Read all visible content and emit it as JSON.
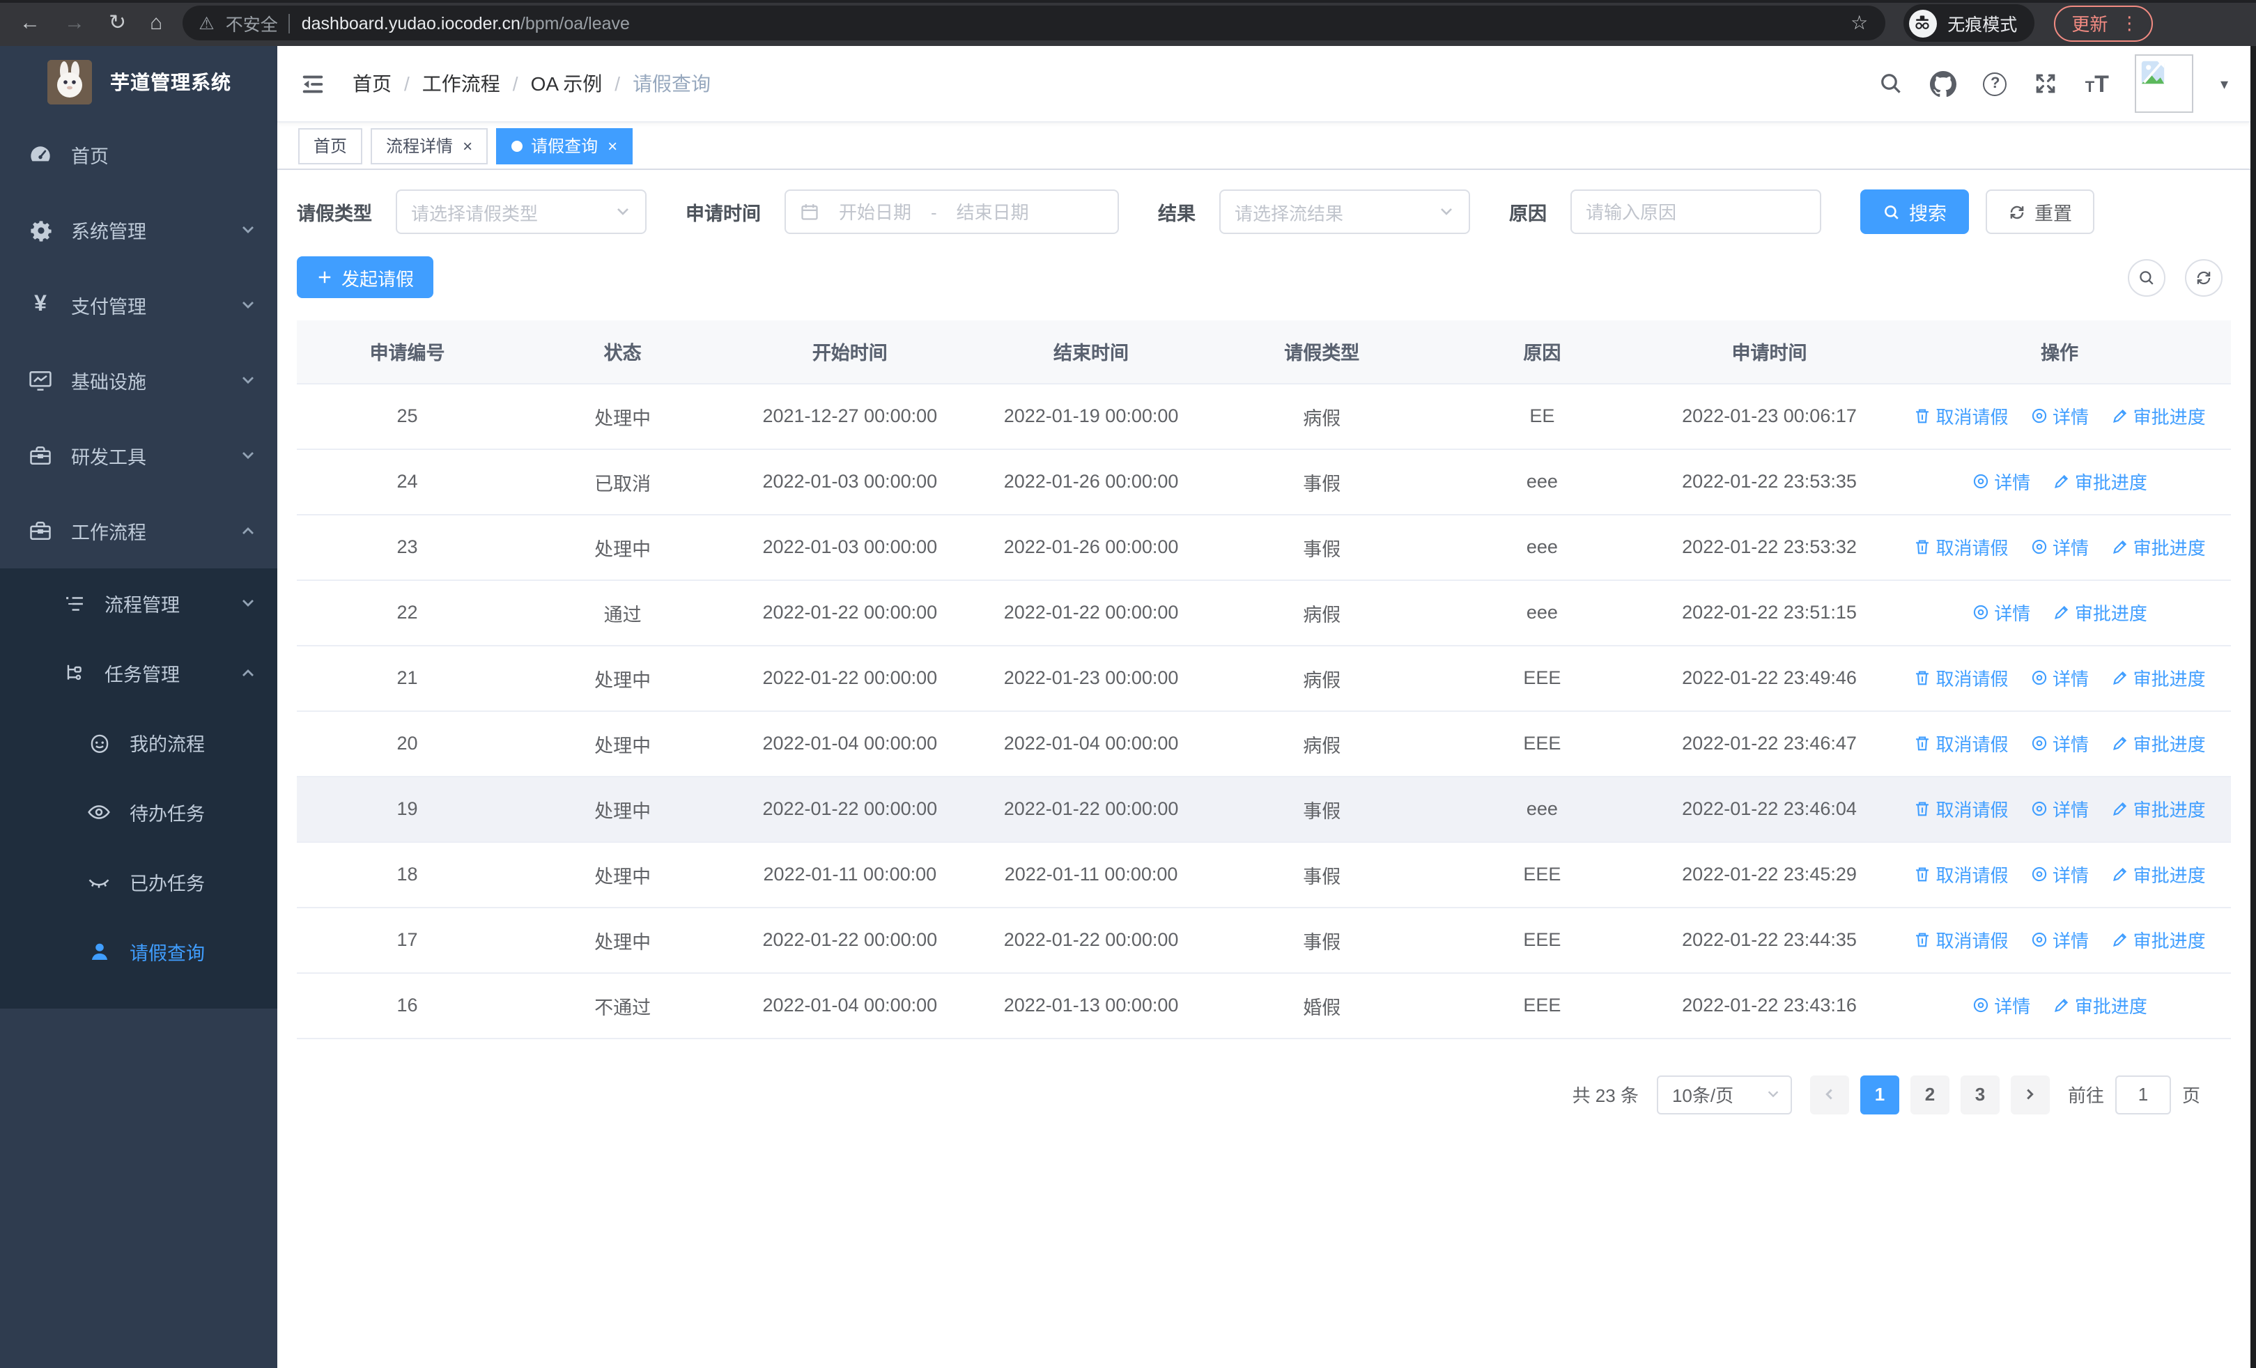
{
  "browser": {
    "security_label": "不安全",
    "url_host": "dashboard.yudao.iocoder.cn",
    "url_path": "/bpm/oa/leave",
    "incognito_label": "无痕模式",
    "update_label": "更新"
  },
  "glyphs": {
    "back": "←",
    "forward": "→",
    "reload": "↻",
    "home": "⌂",
    "warning": "⚠",
    "star": "☆",
    "dots": "⋮",
    "caret": "▾",
    "question": "?",
    "font_small": "T",
    "font_large": "T",
    "close": "×",
    "dash": "-"
  },
  "sidebar": {
    "app_title": "芋道管理系统",
    "items": [
      {
        "label": "首页"
      },
      {
        "label": "系统管理"
      },
      {
        "label": "支付管理"
      },
      {
        "label": "基础设施"
      },
      {
        "label": "研发工具"
      },
      {
        "label": "工作流程"
      }
    ],
    "workflow_children": {
      "process_mgmt": "流程管理",
      "task_mgmt": "任务管理",
      "my_process": "我的流程",
      "todo_tasks": "待办任务",
      "done_tasks": "已办任务",
      "leave_query": "请假查询"
    }
  },
  "breadcrumb": {
    "items": [
      "首页",
      "工作流程",
      "OA 示例",
      "请假查询"
    ],
    "separator": "/"
  },
  "tabs": [
    {
      "label": "首页"
    },
    {
      "label": "流程详情"
    },
    {
      "label": "请假查询"
    }
  ],
  "filters": {
    "type_label": "请假类型",
    "type_placeholder": "请选择请假类型",
    "time_label": "申请时间",
    "start_placeholder": "开始日期",
    "end_placeholder": "结束日期",
    "result_label": "结果",
    "result_placeholder": "请选择流结果",
    "reason_label": "原因",
    "reason_placeholder": "请输入原因",
    "search_label": "搜索",
    "reset_label": "重置"
  },
  "toolbar": {
    "create_label": "发起请假"
  },
  "table": {
    "headers": [
      "申请编号",
      "状态",
      "开始时间",
      "结束时间",
      "请假类型",
      "原因",
      "申请时间",
      "操作"
    ],
    "action_labels": {
      "cancel": "取消请假",
      "detail": "详情",
      "progress": "审批进度"
    },
    "rows": [
      {
        "id": "25",
        "status": "处理中",
        "start": "2021-12-27 00:00:00",
        "end": "2022-01-19 00:00:00",
        "type": "病假",
        "reason": "EE",
        "applyTime": "2022-01-23 00:06:17",
        "actions": [
          "cancel",
          "detail",
          "progress"
        ]
      },
      {
        "id": "24",
        "status": "已取消",
        "start": "2022-01-03 00:00:00",
        "end": "2022-01-26 00:00:00",
        "type": "事假",
        "reason": "eee",
        "applyTime": "2022-01-22 23:53:35",
        "actions": [
          "detail",
          "progress"
        ]
      },
      {
        "id": "23",
        "status": "处理中",
        "start": "2022-01-03 00:00:00",
        "end": "2022-01-26 00:00:00",
        "type": "事假",
        "reason": "eee",
        "applyTime": "2022-01-22 23:53:32",
        "actions": [
          "cancel",
          "detail",
          "progress"
        ]
      },
      {
        "id": "22",
        "status": "通过",
        "start": "2022-01-22 00:00:00",
        "end": "2022-01-22 00:00:00",
        "type": "病假",
        "reason": "eee",
        "applyTime": "2022-01-22 23:51:15",
        "actions": [
          "detail",
          "progress"
        ]
      },
      {
        "id": "21",
        "status": "处理中",
        "start": "2022-01-22 00:00:00",
        "end": "2022-01-23 00:00:00",
        "type": "病假",
        "reason": "EEE",
        "applyTime": "2022-01-22 23:49:46",
        "actions": [
          "cancel",
          "detail",
          "progress"
        ]
      },
      {
        "id": "20",
        "status": "处理中",
        "start": "2022-01-04 00:00:00",
        "end": "2022-01-04 00:00:00",
        "type": "病假",
        "reason": "EEE",
        "applyTime": "2022-01-22 23:46:47",
        "actions": [
          "cancel",
          "detail",
          "progress"
        ]
      },
      {
        "id": "19",
        "status": "处理中",
        "start": "2022-01-22 00:00:00",
        "end": "2022-01-22 00:00:00",
        "type": "事假",
        "reason": "eee",
        "applyTime": "2022-01-22 23:46:04",
        "actions": [
          "cancel",
          "detail",
          "progress"
        ],
        "highlight": true
      },
      {
        "id": "18",
        "status": "处理中",
        "start": "2022-01-11 00:00:00",
        "end": "2022-01-11 00:00:00",
        "type": "事假",
        "reason": "EEE",
        "applyTime": "2022-01-22 23:45:29",
        "actions": [
          "cancel",
          "detail",
          "progress"
        ]
      },
      {
        "id": "17",
        "status": "处理中",
        "start": "2022-01-22 00:00:00",
        "end": "2022-01-22 00:00:00",
        "type": "事假",
        "reason": "EEE",
        "applyTime": "2022-01-22 23:44:35",
        "actions": [
          "cancel",
          "detail",
          "progress"
        ]
      },
      {
        "id": "16",
        "status": "不通过",
        "start": "2022-01-04 00:00:00",
        "end": "2022-01-13 00:00:00",
        "type": "婚假",
        "reason": "EEE",
        "applyTime": "2022-01-22 23:43:16",
        "actions": [
          "detail",
          "progress"
        ]
      }
    ]
  },
  "pagination": {
    "total_label": "共 23 条",
    "page_size": "10条/页",
    "pages": [
      "1",
      "2",
      "3"
    ],
    "active_page": "1",
    "goto_label": "前往",
    "goto_value": "1",
    "page_suffix": "页"
  },
  "colors": {
    "accent": "#409eff",
    "sidebar_bg": "#2f3c4f",
    "submenu_bg": "#1f2d3d"
  }
}
